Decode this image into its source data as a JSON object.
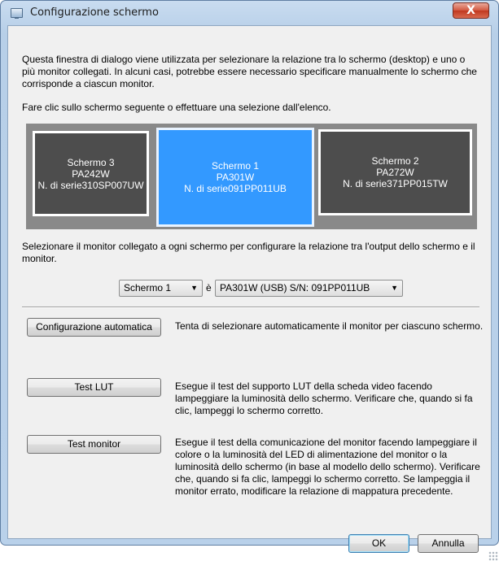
{
  "window": {
    "title": "Configurazione schermo",
    "close_label": "X"
  },
  "intro_text": "Questa finestra di dialogo viene utilizzata per selezionare la relazione tra lo schermo (desktop) e uno o più monitor collegati. In alcuni casi, potrebbe essere necessario specificare manualmente lo schermo che corrisponde a ciascun monitor.",
  "instruction_text": "Fare clic sullo schermo seguente o effettuare una selezione dall'elenco.",
  "screens": [
    {
      "name": "Schermo 3",
      "model": "PA242W",
      "serial": "N. di serie310SP007UW",
      "selected": false
    },
    {
      "name": "Schermo 1",
      "model": "PA301W",
      "serial": "N. di serie091PP011UB",
      "selected": true
    },
    {
      "name": "Schermo 2",
      "model": "PA272W",
      "serial": "N. di serie371PP015TW",
      "selected": false
    }
  ],
  "select_description": "Selezionare il monitor collegato a ogni schermo per configurare la relazione tra l'output dello schermo e il monitor.",
  "mapping": {
    "screen_value": "Schermo 1",
    "is_label": "è",
    "monitor_value": "PA301W (USB) S/N: 091PP011UB"
  },
  "actions": [
    {
      "label": "Configurazione automatica",
      "description": "Tenta di selezionare automaticamente il monitor per ciascuno schermo."
    },
    {
      "label": "Test LUT",
      "description": "Esegue il test del supporto LUT della scheda video facendo lampeggiare la luminosità dello schermo. Verificare che, quando si fa clic, lampeggi lo schermo corretto."
    },
    {
      "label": "Test monitor",
      "description": "Esegue il test della comunicazione del monitor facendo lampeggiare il colore o la luminosità del LED di alimentazione del monitor o la luminosità dello schermo (in base al modello dello schermo). Verificare che, quando si fa clic, lampeggi lo schermo corretto. Se lampeggia il monitor errato, modificare la relazione di mappatura precedente."
    }
  ],
  "footer": {
    "ok_label": "OK",
    "cancel_label": "Annulla"
  },
  "colors": {
    "selected_screen": "#3399ff",
    "unselected_screen": "#4d4d4d",
    "screen_area": "#898989",
    "close_button": "#c7412a"
  }
}
